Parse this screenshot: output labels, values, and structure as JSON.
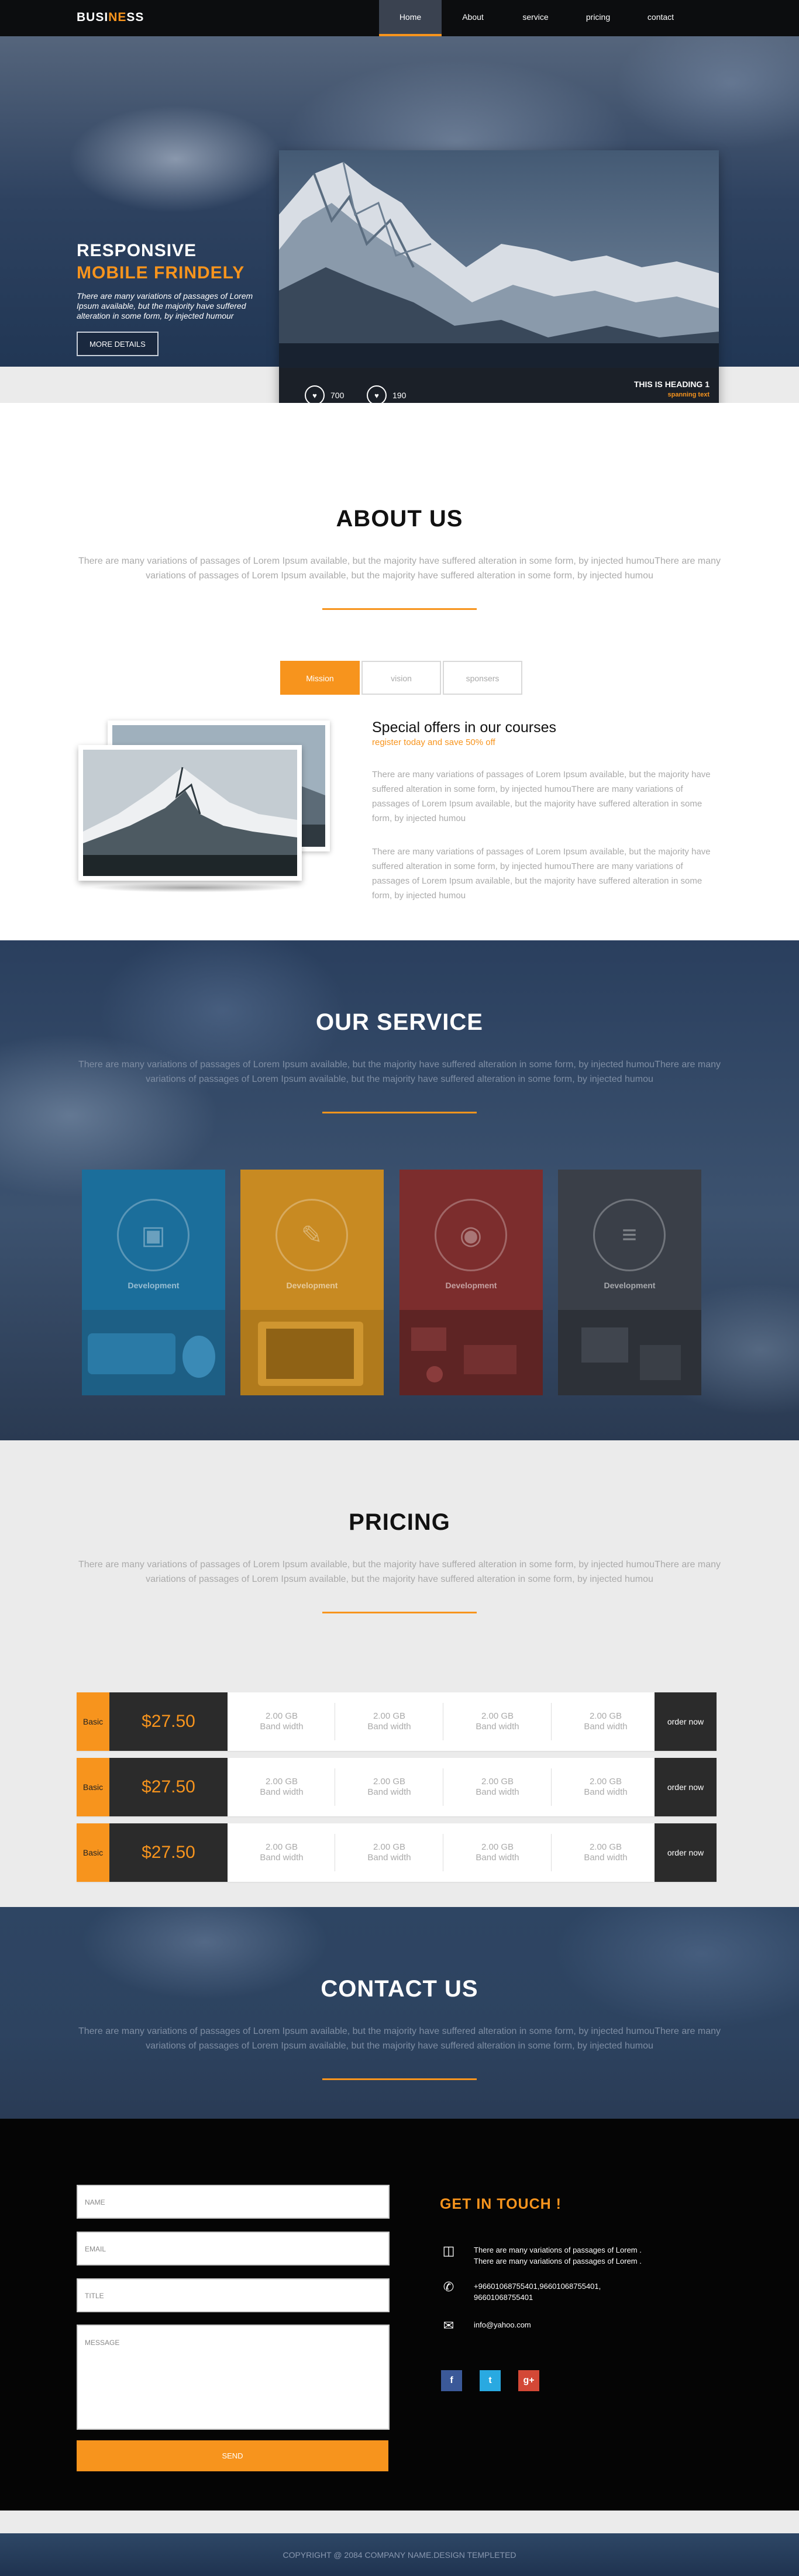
{
  "brand": {
    "part1": "BUSI",
    "accent": "NE",
    "part2": "SS",
    "accent_color": "#f7941d"
  },
  "nav": {
    "items": [
      "Home",
      "About",
      "service",
      "pricing",
      "contact"
    ],
    "active": "Home"
  },
  "hero": {
    "title1": "RESPONSIVE",
    "title2": "MOBILE FRINDELY",
    "description": "There are many variations of passages of Lorem Ipsum available, but the majority have suffered alteration in some form, by injected humour",
    "button": "MORE DETAILS",
    "card": {
      "likes": "700",
      "loves": "190",
      "heading": "THIS IS HEADING 1",
      "subheading": "spanning text",
      "like_icon": "heart-icon"
    }
  },
  "about": {
    "title": "ABOUT US",
    "description": "There are many variations of passages of Lorem Ipsum available, but the majority have suffered alteration in some form, by injected humouThere are many variations of passages of Lorem Ipsum available, but the majority have suffered alteration in some form, by injected humou",
    "tabs": [
      "Mission",
      "vision",
      "sponsers"
    ],
    "active_tab": "Mission",
    "offer_title": "Special offers in our courses",
    "offer_sub": "register today and save 50% off",
    "paragraphs": [
      "There are many variations of passages of Lorem Ipsum available, but the majority have suffered alteration in some form, by injected humouThere are many variations of passages of Lorem Ipsum available, but the majority have suffered alteration in some form, by injected humou",
      "There are many variations of passages of Lorem Ipsum available, but the majority have suffered alteration in some form, by injected humouThere are many variations of passages of Lorem Ipsum available, but the majority have suffered alteration in some form, by injected humou"
    ]
  },
  "service": {
    "title": "OUR SERVICE",
    "description": "There are many variations of passages of Lorem Ipsum available, but the majority have suffered alteration in some form, by injected humouThere are many variations of passages of Lorem Ipsum available, but the majority have suffered alteration in some form, by injected humou",
    "tiles": [
      {
        "label": "Development",
        "icon": "monitor-icon",
        "color": "#1b6e9b"
      },
      {
        "label": "Development",
        "icon": "pencil-icon",
        "color": "#c88a22"
      },
      {
        "label": "Development",
        "icon": "location-pin-icon",
        "color": "#8a2f2f"
      },
      {
        "label": "Development",
        "icon": "sliders-icon",
        "color": "#3a3f48"
      }
    ]
  },
  "pricing": {
    "title": "PRICING",
    "description": "There are many variations of passages of Lorem Ipsum available, but the majority have suffered alteration in some form, by injected humouThere are many variations of passages of Lorem Ipsum available, but the majority have suffered alteration in some form, by injected humou",
    "rows": [
      {
        "label": "Basic",
        "price": "$27.50",
        "features": [
          [
            "2.00 GB",
            "Band width"
          ],
          [
            "2.00 GB",
            "Band width"
          ],
          [
            "2.00 GB",
            "Band width"
          ],
          [
            "2.00 GB",
            "Band width"
          ]
        ],
        "order": "order now"
      },
      {
        "label": "Basic",
        "price": "$27.50",
        "features": [
          [
            "2.00 GB",
            "Band width"
          ],
          [
            "2.00 GB",
            "Band width"
          ],
          [
            "2.00 GB",
            "Band width"
          ],
          [
            "2.00 GB",
            "Band width"
          ]
        ],
        "order": "order now"
      },
      {
        "label": "Basic",
        "price": "$27.50",
        "features": [
          [
            "2.00 GB",
            "Band width"
          ],
          [
            "2.00 GB",
            "Band width"
          ],
          [
            "2.00 GB",
            "Band width"
          ],
          [
            "2.00 GB",
            "Band width"
          ]
        ],
        "order": "order now"
      }
    ]
  },
  "contact": {
    "title": "CONTACT US",
    "description": "There are many variations of passages of Lorem Ipsum available, but the majority have suffered alteration in some form, by injected humouThere are many variations of passages of Lorem Ipsum available, but the majority have suffered alteration in some form, by injected humou",
    "form": {
      "name": "NAME",
      "email": "EMAIL",
      "title": "TITLE",
      "message": "MESSAGE",
      "send": "SEND"
    },
    "get_in_touch": "GET IN TOUCH !",
    "address": [
      "There are many variations of passages of Lorem .",
      "There are many variations of passages of Lorem ."
    ],
    "phone": [
      "+966010687554​01,966010687554​01,",
      "966010687554​01"
    ],
    "email": "info@yahoo.com",
    "social": [
      {
        "icon": "facebook-icon",
        "glyph": "f",
        "color": "#3b5998"
      },
      {
        "icon": "twitter-icon",
        "glyph": "t",
        "color": "#29a9e1"
      },
      {
        "icon": "google-plus-icon",
        "glyph": "g+",
        "color": "#d34836"
      }
    ]
  },
  "footer": {
    "copyright": "COPYRIGHT @ 2084 COMPANY NAME.DESIGN TEMPLETED"
  }
}
